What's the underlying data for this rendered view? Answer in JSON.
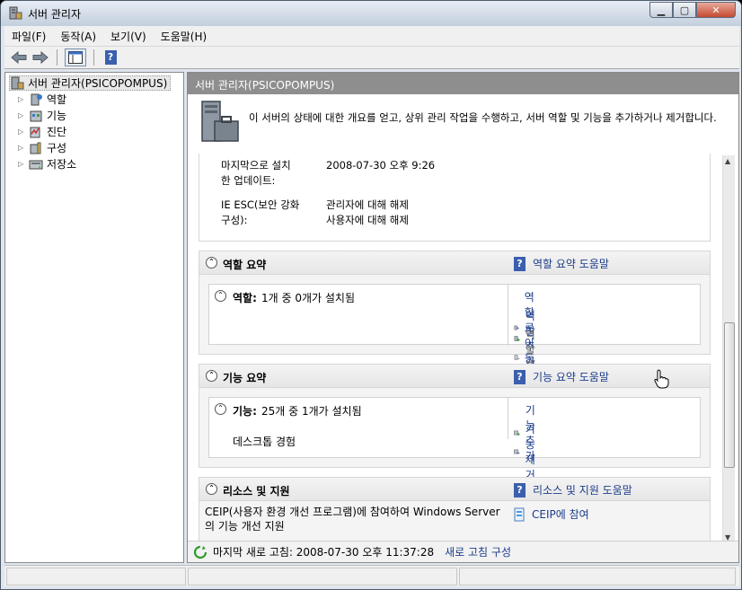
{
  "window": {
    "title": "서버 관리자"
  },
  "menu": [
    "파일(F)",
    "동작(A)",
    "보기(V)",
    "도움말(H)"
  ],
  "tree": {
    "root": "서버 관리자(PSICOPOMPUS)",
    "items": [
      "역할",
      "기능",
      "진단",
      "구성",
      "저장소"
    ]
  },
  "header": {
    "title": "서버 관리자(PSICOPOMPUS)"
  },
  "intro": {
    "text": "이 서버의 상태에 대한 개요를 얻고, 상위 관리 작업을 수행하고, 서버 역할 및 기능을 추가하거나 제거합니다."
  },
  "server_info": {
    "last_update_label": "마지막으로 설치\n한 업데이트:",
    "last_update_value": "2008-07-30 오후 9:26",
    "ie_esc_label": "IE ESC(보안 강화\n구성):",
    "ie_esc_admin": "관리자에 대해 해제",
    "ie_esc_user": "사용자에 대해 해제"
  },
  "roles": {
    "title": "역할 요약",
    "help": "역할 요약 도움말",
    "label": "역할:",
    "count": "1개 중 0개가 설치됨",
    "tasks": [
      "역할로 이동",
      "역할 추가",
      "역할 제거"
    ]
  },
  "features": {
    "title": "기능 요약",
    "help": "기능 요약 도움말",
    "label": "기능:",
    "count": "25개 중 1개가 설치됨",
    "installed": "데스크톱 경험",
    "tasks": [
      "기능 추가",
      "기능 제거"
    ]
  },
  "resources": {
    "title": "리소스 및 지원",
    "help": "리소스 및 지원 도움말",
    "text": "CEIP(사용자 환경 개선 프로그램)에 참여하여 Windows Server\n의 기능 개선 지원",
    "task": "CEIP에 참여"
  },
  "status": {
    "last_refresh": "마지막 새로 고침: 2008-07-30 오후 11:37:28",
    "configure": "새로 고침 구성"
  },
  "colors": {
    "accent_link": "#1c3c8c",
    "header_bg": "#8e8e8e"
  }
}
